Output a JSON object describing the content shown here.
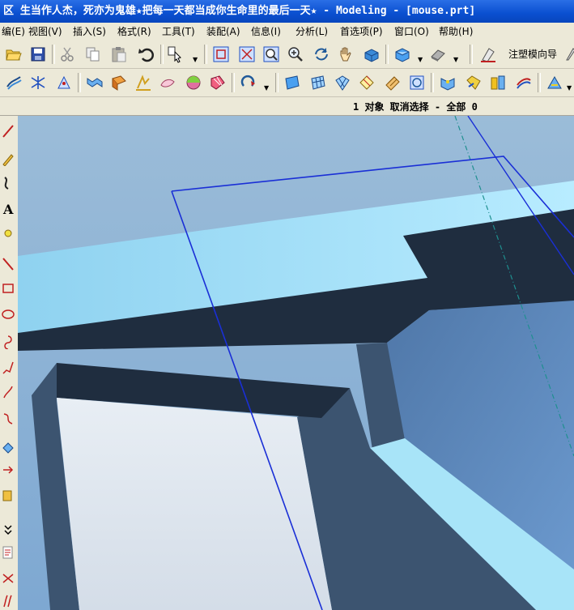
{
  "window": {
    "title": "区  生当作人杰，死亦为鬼雄★把每一天都当成你生命里的最后一天★ - Modeling - [mouse.prt]"
  },
  "menubar": {
    "items": [
      {
        "label": "编(E)"
      },
      {
        "label": "视图(V)"
      },
      {
        "label": "插入(S)"
      },
      {
        "label": "格式(R)"
      },
      {
        "label": "工具(T)"
      },
      {
        "label": "装配(A)"
      },
      {
        "label": "信息(I)"
      },
      {
        "label": "分析(L)"
      },
      {
        "label": "首选项(P)"
      },
      {
        "label": "窗口(O)"
      },
      {
        "label": "帮助(H)"
      }
    ]
  },
  "toolbar1": {
    "plastic_wizard_label": "注塑模向导"
  },
  "status": {
    "selection_text": "1 对象 取消选择  - 全部 0"
  },
  "colors": {
    "title_bar": "#0a4fd0",
    "viewport_bg": "#6f9bcf",
    "light_face": "#a8e4f8",
    "dark_face": "#1f2d3f",
    "white_face": "#dce4ec",
    "mid_face": "#3c5470",
    "blue_wire": "#1a2fd6",
    "axis_dash": "#1f8f8f"
  }
}
